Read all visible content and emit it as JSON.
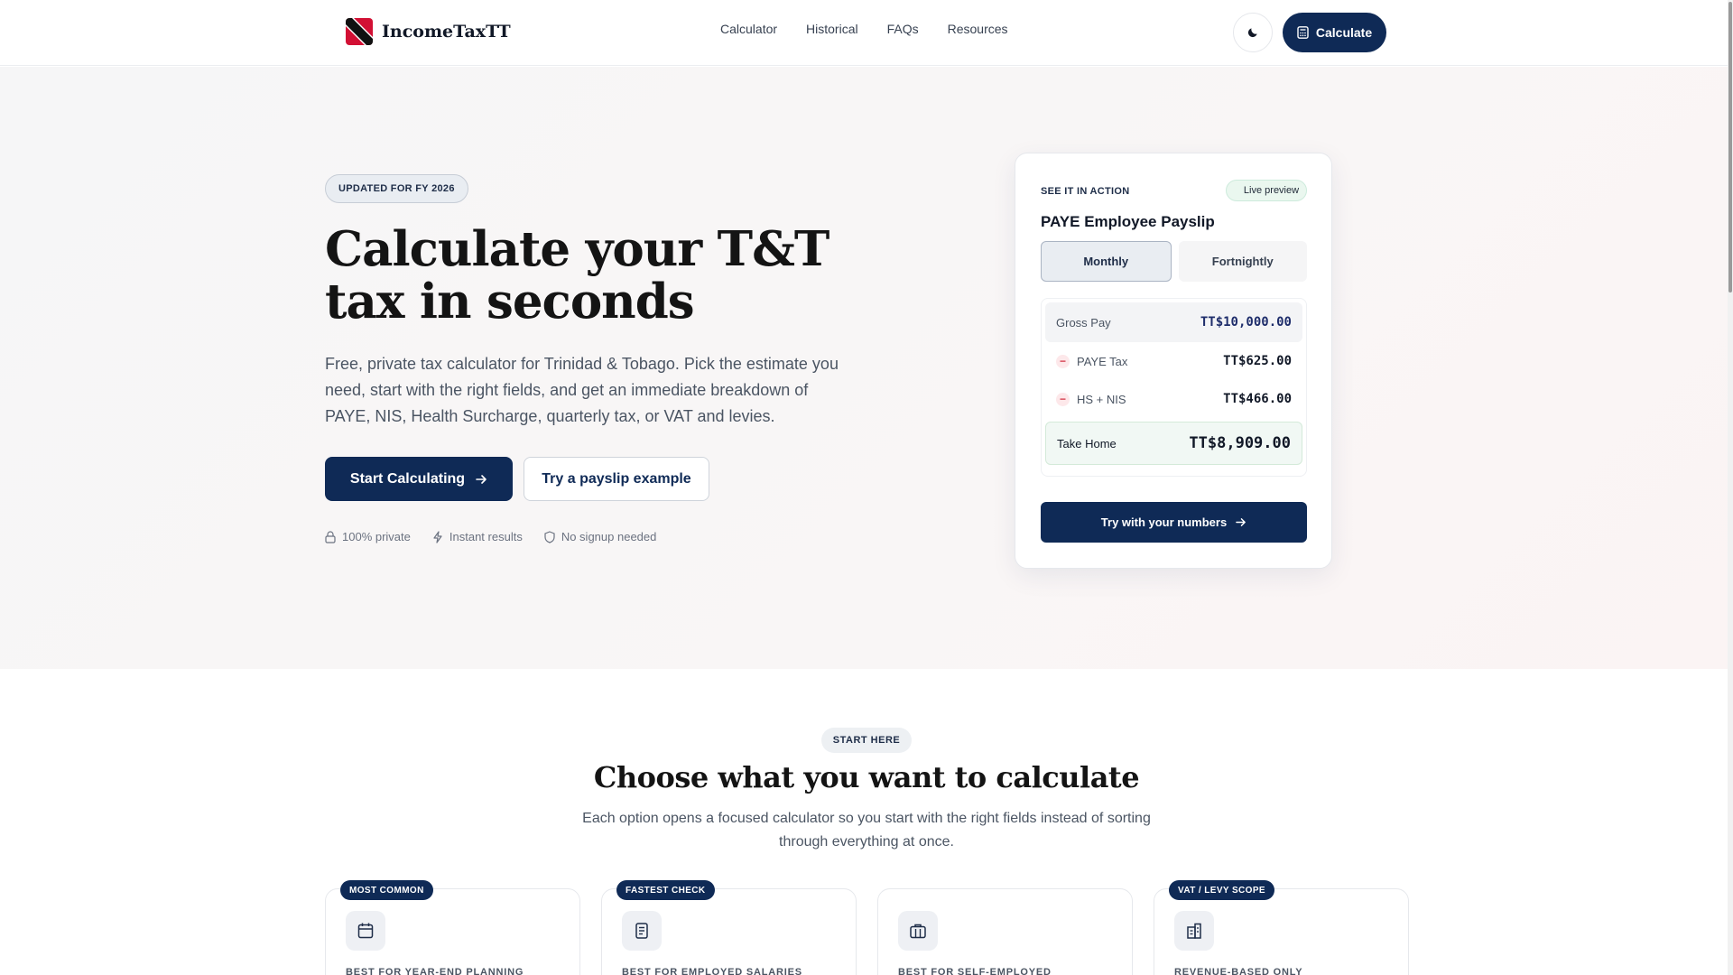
{
  "nav": {
    "brand": "IncomeTaxTT",
    "links": [
      "Calculator",
      "Historical",
      "FAQs",
      "Resources"
    ],
    "cta": "Calculate"
  },
  "hero": {
    "badge": "UPDATED FOR FY 2026",
    "title": "Calculate your T&T tax in seconds",
    "subtitle": "Free, private tax calculator for Trinidad & Tobago. Pick the estimate you need, start with the right fields, and get an immediate breakdown of PAYE, NIS, Health Surcharge, quarterly tax, or VAT and levies.",
    "primary_cta": "Start Calculating",
    "secondary_cta": "Try a payslip example",
    "trust": [
      "100% private",
      "Instant results",
      "No signup needed"
    ]
  },
  "preview": {
    "eyebrow": "SEE IT IN ACTION",
    "live": "Live preview",
    "title": "PAYE Employee Payslip",
    "tabs": [
      "Monthly",
      "Fortnightly"
    ],
    "rows": {
      "gross_label": "Gross Pay",
      "gross_value": "TT$10,000.00",
      "paye_label": "PAYE Tax",
      "paye_value": "TT$625.00",
      "hs_label": "HS + NIS",
      "hs_value": "TT$466.00",
      "take_label": "Take Home",
      "take_value": "TT$8,909.00"
    },
    "cta": "Try with your numbers"
  },
  "options_section": {
    "pill": "START HERE",
    "title": "Choose what you want to calculate",
    "subtitle": "Each option opens a focused calculator so you start with the right fields instead of sorting through everything at once.",
    "cards": [
      {
        "tag": "MOST COMMON",
        "icon": "calendar-icon",
        "best": "BEST FOR YEAR-END PLANNING"
      },
      {
        "tag": "FASTEST CHECK",
        "icon": "document-icon",
        "best": "BEST FOR EMPLOYED SALARIES"
      },
      {
        "tag": "",
        "icon": "briefcase-icon",
        "best": "BEST FOR SELF-EMPLOYED"
      },
      {
        "tag": "VAT / LEVY SCOPE",
        "icon": "building-icon",
        "best": "REVENUE-BASED ONLY"
      }
    ]
  },
  "colors": {
    "brand": "#0f2a56",
    "accent_red": "#d43b4b",
    "success_bg": "#eaf7ef"
  }
}
